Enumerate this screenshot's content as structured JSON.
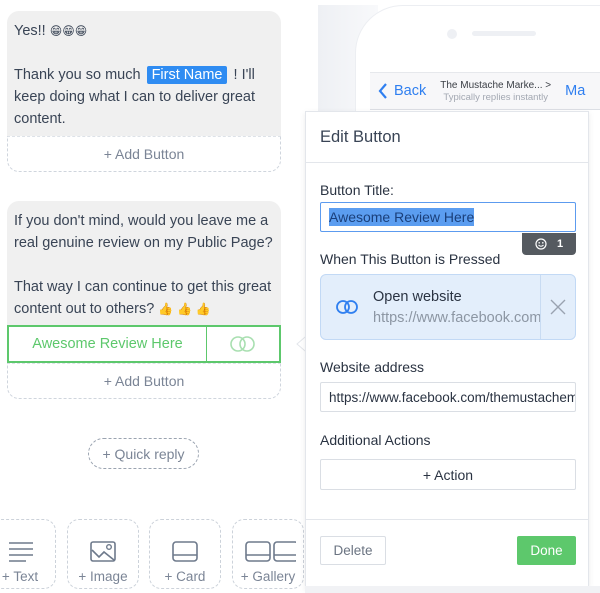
{
  "builder": {
    "message_1": {
      "line1": "Yes!! ",
      "line1_emoji": "😁😁😁",
      "line2_before": "Thank you so much ",
      "variable_chip": "First Name",
      "line2_after": " ! I'll keep doing what I can to deliver great content.",
      "add_button": "+ Add Button"
    },
    "message_2": {
      "paragraph1": "If you don't mind, would you leave me a real genuine review on my Public Page?",
      "paragraph2": "That way I can continue to get this great content out to others? ",
      "paragraph2_emoji": "👍 👍 👍",
      "button_title": "Awesome Review Here",
      "button_icon": "link-icon",
      "add_button": "+ Add Button"
    },
    "quick_reply": "+ Quick reply",
    "add_tiles": [
      {
        "label": "+ Text",
        "icon": "text-lines-icon"
      },
      {
        "label": "+ Image",
        "icon": "image-icon"
      },
      {
        "label": "+ Card",
        "icon": "card-icon"
      },
      {
        "label": "+ Gallery",
        "icon": "gallery-icon"
      }
    ]
  },
  "preview_header": {
    "back_label": "Back",
    "page_name": "The Mustache Marke... >",
    "status": "Typically replies instantly",
    "manage_label": "Ma"
  },
  "edit_panel": {
    "title": "Edit Button",
    "button_title_label": "Button Title:",
    "button_title_value": "Awesome Review Here",
    "emoji_counter": "1",
    "when_pressed_label": "When This Button is Pressed",
    "action": {
      "title": "Open website",
      "url": "https://www.facebook.com/themustachemarketer"
    },
    "website_label": "Website address",
    "website_value": "https://www.facebook.com/themustachemarketer",
    "additional_actions_label": "Additional Actions",
    "add_action": "+ Action",
    "delete": "Delete",
    "done": "Done"
  },
  "colors": {
    "accent_green": "#5dc86c",
    "link_blue": "#2f7ff0",
    "variable_chip": "#2f8cf2",
    "action_card_bg": "#e3eefb"
  }
}
